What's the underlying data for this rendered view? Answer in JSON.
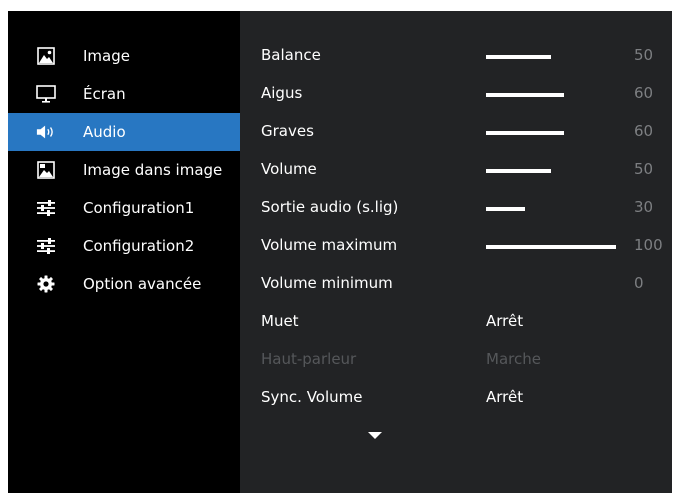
{
  "sidebar": {
    "items": [
      {
        "label": "Image",
        "icon": "picture-icon"
      },
      {
        "label": "Écran",
        "icon": "monitor-icon"
      },
      {
        "label": "Audio",
        "icon": "speaker-icon",
        "active": true
      },
      {
        "label": "Image dans image",
        "icon": "picture-in-picture-icon"
      },
      {
        "label": "Configuration1",
        "icon": "sliders-icon"
      },
      {
        "label": "Configuration2",
        "icon": "sliders-icon"
      },
      {
        "label": "Option avancée",
        "icon": "gear-icon"
      }
    ],
    "active_color": "#2877c2"
  },
  "audio": {
    "rows": [
      {
        "name": "Balance",
        "level": 50,
        "value": "50"
      },
      {
        "name": "Aigus",
        "level": 60,
        "value": "60"
      },
      {
        "name": "Graves",
        "level": 60,
        "value": "60"
      },
      {
        "name": "Volume",
        "level": 50,
        "value": "50"
      },
      {
        "name": "Sortie audio (s.lig)",
        "level": 30,
        "value": "30"
      },
      {
        "name": "Volume maximum",
        "level": 100,
        "value": "100"
      },
      {
        "name": "Volume minimum",
        "level": 0,
        "value": "0"
      },
      {
        "name": "Muet",
        "value": "Arrêt"
      },
      {
        "name": "Haut-parleur",
        "value": "Marche",
        "disabled": true
      },
      {
        "name": "Sync. Volume",
        "value": "Arrêt"
      }
    ],
    "scroll_icon": "chevron-down-icon"
  }
}
